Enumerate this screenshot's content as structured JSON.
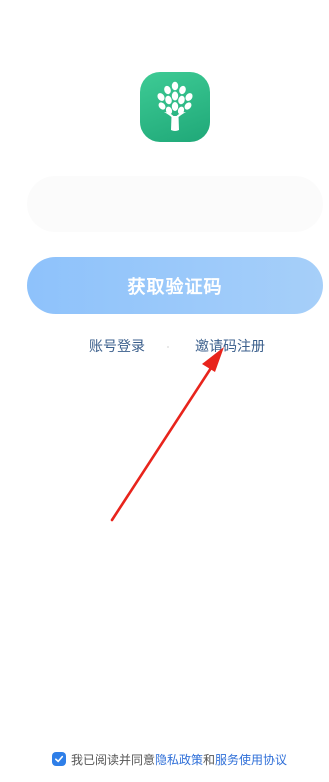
{
  "app": {
    "logo_icon": "tree-icon",
    "brand_color": "#25b884"
  },
  "login": {
    "phone_input_value": "",
    "primary_button_label": "获取验证码",
    "primary_button_color": "#8ec2fb",
    "links": {
      "account_login": "账号登录",
      "invite_register": "邀请码注册"
    }
  },
  "annotation": {
    "arrow_icon": "red-arrow-icon",
    "arrow_color": "#e8241c"
  },
  "agreement": {
    "checked": true,
    "checkbox_icon": "checkbox-checked-icon",
    "prefix": "我已阅读并同意",
    "privacy_link": "隐私政策",
    "connector": "和",
    "service_link": "服务使用协议"
  }
}
